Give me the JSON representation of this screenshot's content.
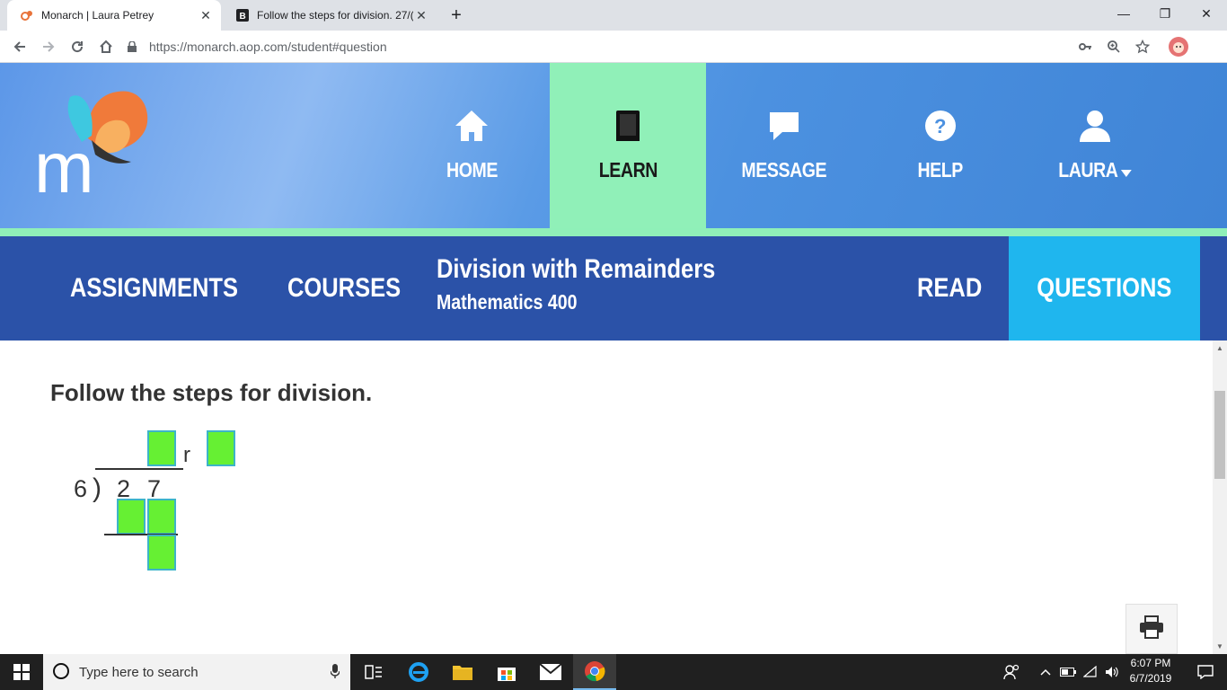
{
  "browser": {
    "tabs": [
      {
        "title": "Monarch | Laura Petrey",
        "active": true
      },
      {
        "title": "Follow the steps for division. 27/(",
        "active": false
      }
    ],
    "url": "https://monarch.aop.com/student#question"
  },
  "nav": {
    "items": [
      {
        "label": "HOME",
        "icon": "home-icon"
      },
      {
        "label": "LEARN",
        "icon": "book-icon",
        "active": true
      },
      {
        "label": "MESSAGE",
        "icon": "chat-bubble-icon"
      },
      {
        "label": "HELP",
        "icon": "question-icon"
      },
      {
        "label": "LAURA",
        "icon": "user-icon"
      }
    ]
  },
  "subnav": {
    "assignments": "ASSIGNMENTS",
    "courses": "COURSES",
    "lesson_title": "Division with Remainders",
    "course_name": "Mathematics 400",
    "read": "READ",
    "questions": "QUESTIONS"
  },
  "question": {
    "title": "Follow the steps for division.",
    "divisor": "6",
    "dividend_tens": "2",
    "dividend_ones": "7",
    "remainder_label": "r"
  },
  "taskbar": {
    "search_placeholder": "Type here to search",
    "time": "6:07 PM",
    "date": "6/7/2019"
  },
  "colors": {
    "header_blue": "#4c91e0",
    "learn_green": "#90f0b8",
    "subnav_blue": "#2b52a8",
    "questions_cyan": "#1fb6ee",
    "answer_box_green": "#66f033"
  }
}
